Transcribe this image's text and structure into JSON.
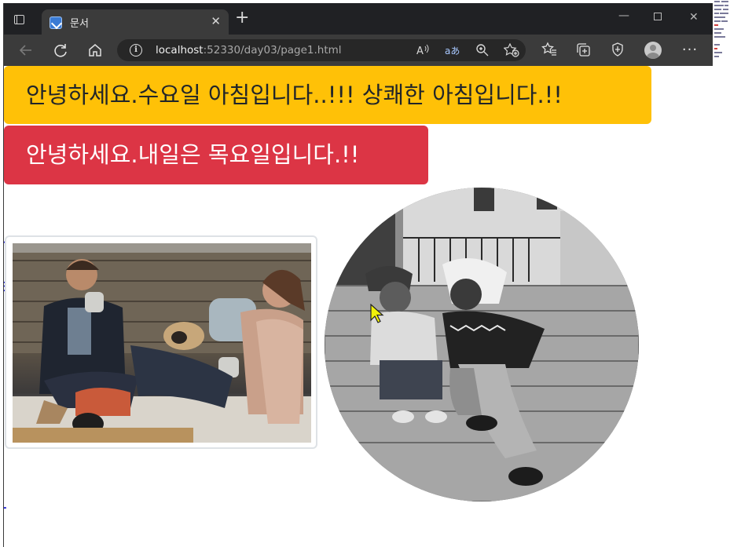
{
  "browser": {
    "tab_title": "문서",
    "tab_close": "✕",
    "new_tab": "+",
    "url_host": "localhost",
    "url_rest": ":52330/day03/page1.html",
    "window_controls": {
      "minimize": "—",
      "close": "✕"
    }
  },
  "icons": {
    "back": "back-arrow-icon",
    "reload": "reload-icon",
    "home": "home-icon",
    "info": "site-info-icon",
    "read_aloud": "read-aloud-icon",
    "translate": "translate-icon",
    "zoom": "zoom-icon",
    "add_favorite": "add-favorite-icon",
    "favorites": "favorites-icon",
    "collections": "collections-icon",
    "security": "shield-icon",
    "profile": "profile-icon",
    "more": "more-icon"
  },
  "page": {
    "alert_warning": "안녕하세요.수요일 아침입니다..!!! 상쾌한 아침입니다.!!",
    "alert_danger": "안녕하세요.내일은 목요일입니다.!!",
    "colors": {
      "warning": "#ffc107",
      "danger": "#dc3545"
    }
  }
}
